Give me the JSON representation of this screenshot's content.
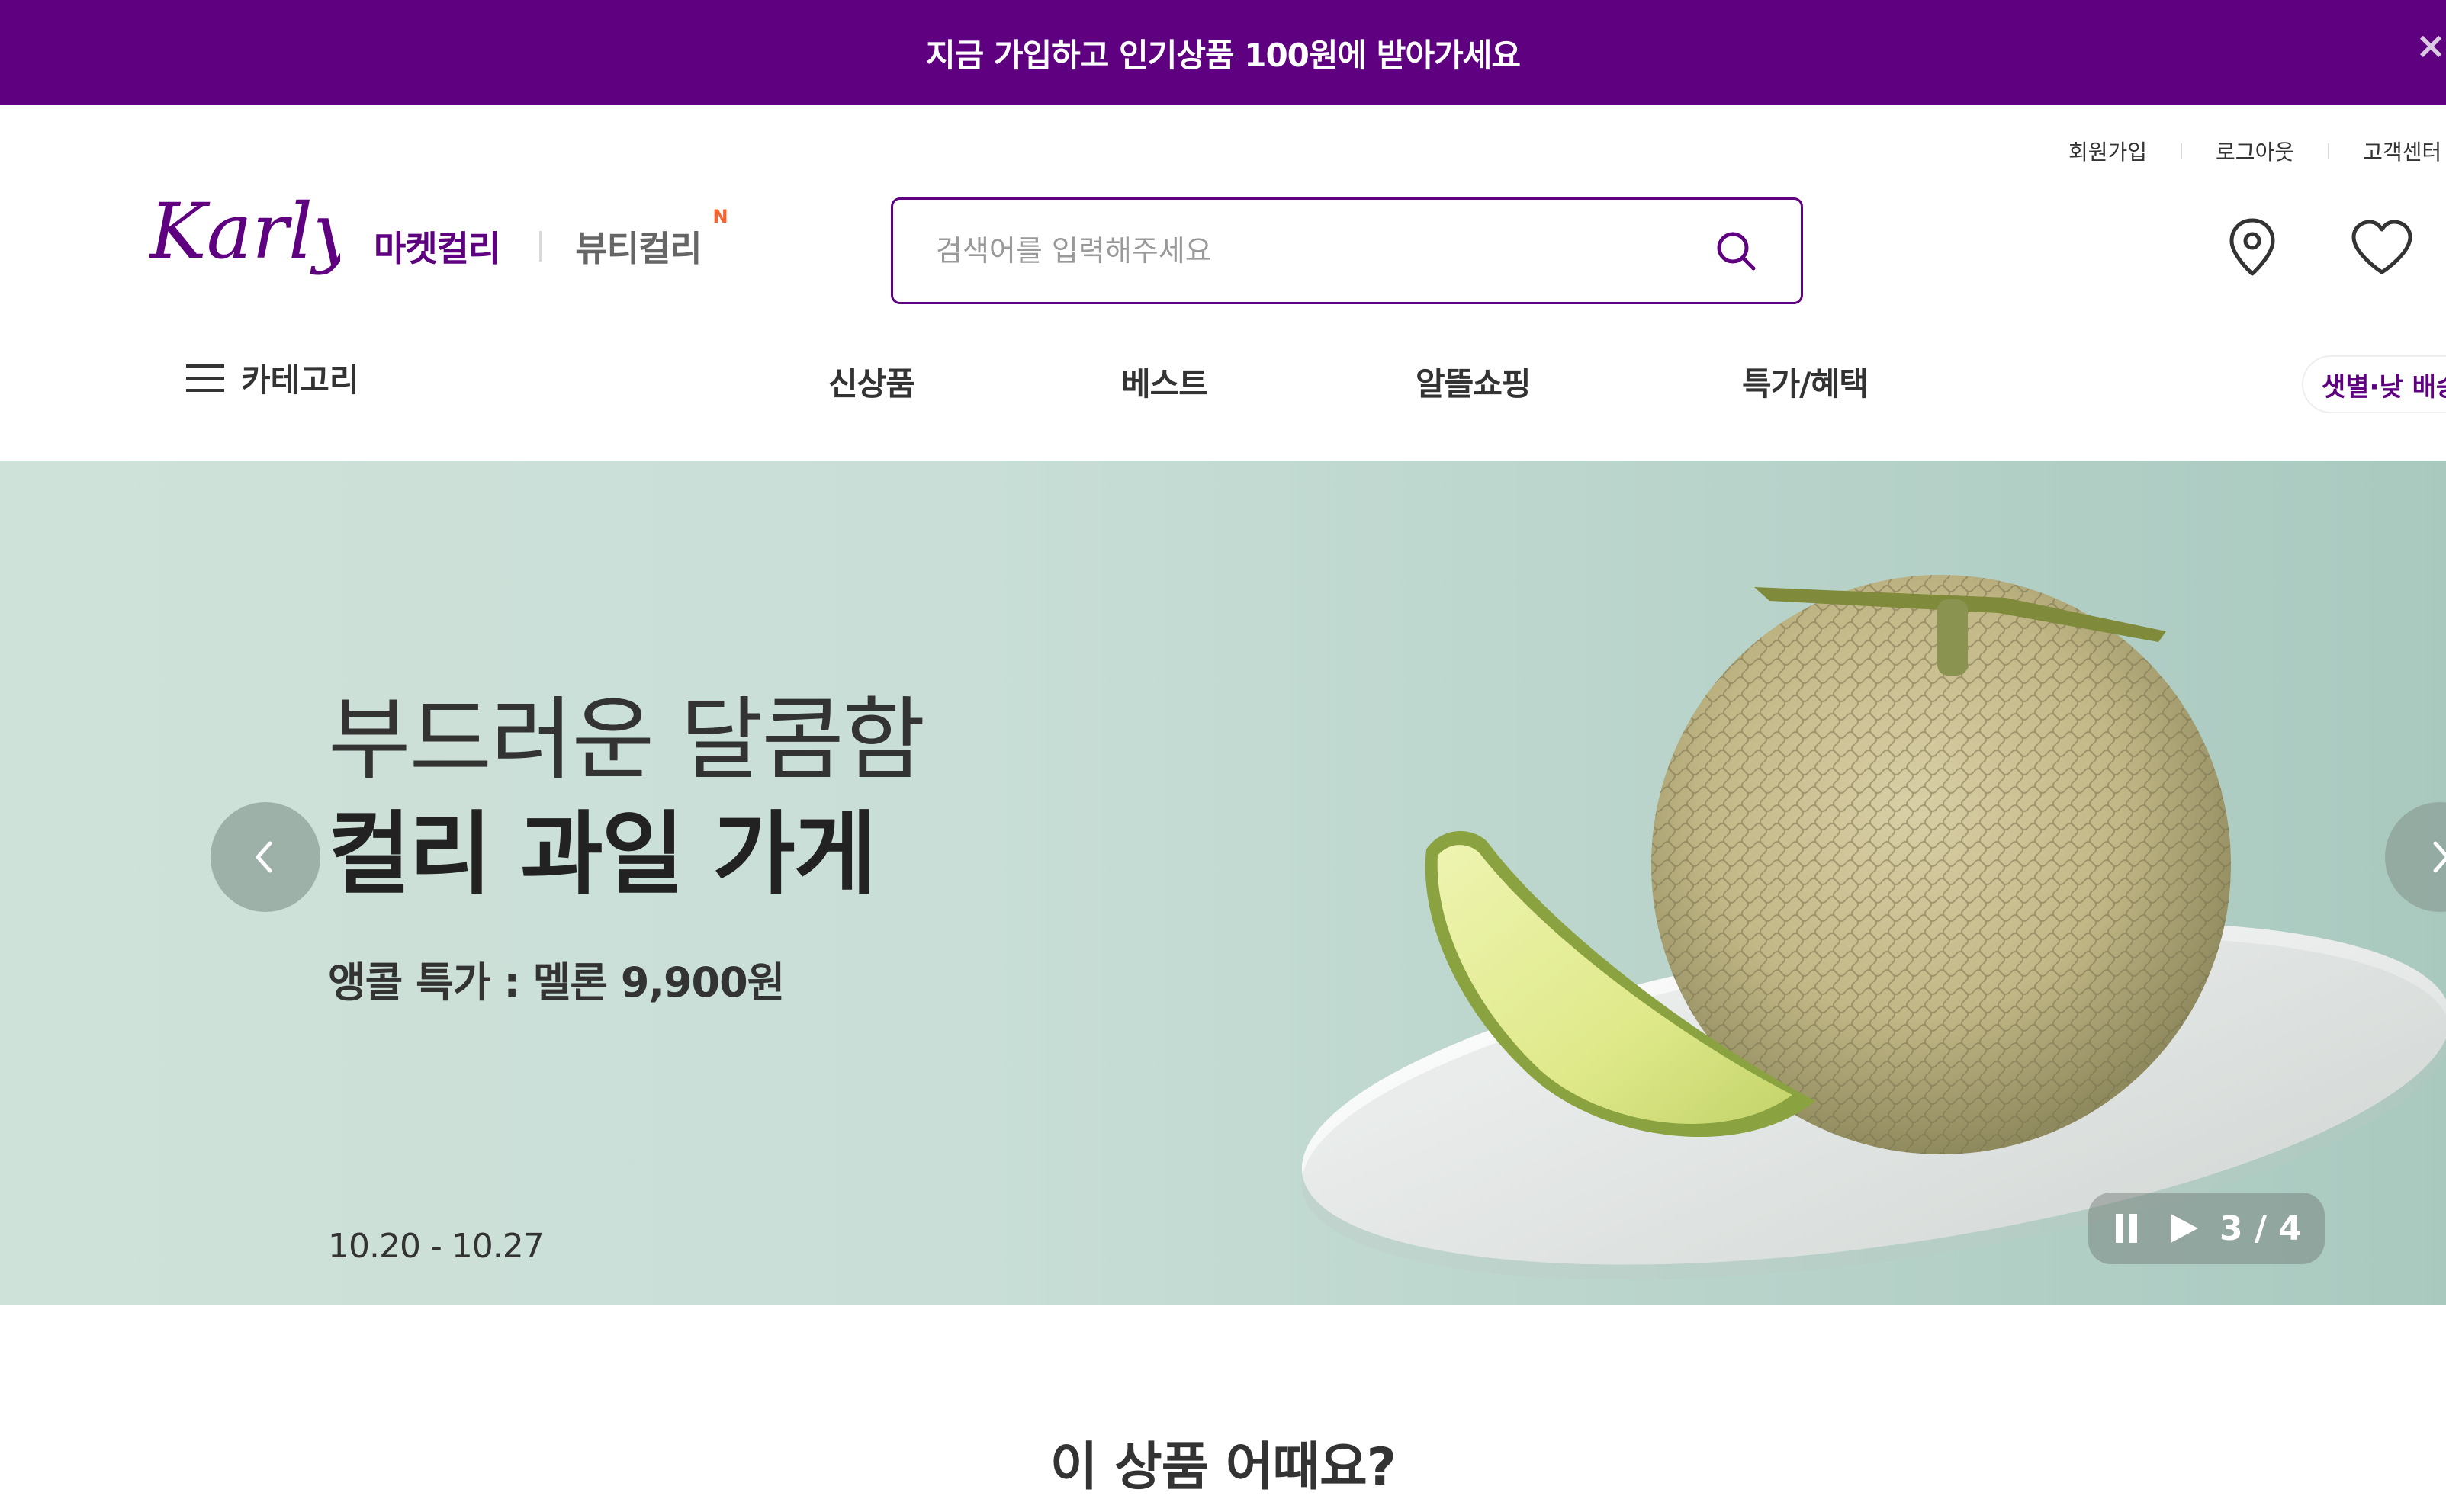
{
  "promo_banner": {
    "text": "지금 가입하고 인기상품 100원에 받아가세요",
    "close_label": "×"
  },
  "header": {
    "util_links": [
      "회원가입",
      "로그아웃",
      "고객센터"
    ],
    "logo_text": "Karly",
    "mall_tabs": {
      "active": "마켓컬리",
      "inactive": "뷰티컬리",
      "new_badge": "N"
    },
    "search": {
      "placeholder": "검색어를 입력해주세요",
      "value": ""
    },
    "icons": [
      "location-icon",
      "heart-icon"
    ]
  },
  "gnb": {
    "category_label": "카테고리",
    "items": [
      "신상품",
      "베스트",
      "알뜰쇼핑",
      "특가/혜택"
    ],
    "delivery_pill": "샛별·낮 배송"
  },
  "hero": {
    "title_line1": "부드러운 달콤함",
    "title_line2": "컬리 과일 가게",
    "subtitle": "앵콜 특가 : 멜론 9,900원",
    "date_range": "10.20 - 10.27",
    "slide_counter": "3 / 4",
    "bg_color": "#c8ded6"
  },
  "section": {
    "title": "이 상품 어때요?"
  },
  "colors": {
    "brand": "#5f0080",
    "badge": "#fa622f"
  }
}
